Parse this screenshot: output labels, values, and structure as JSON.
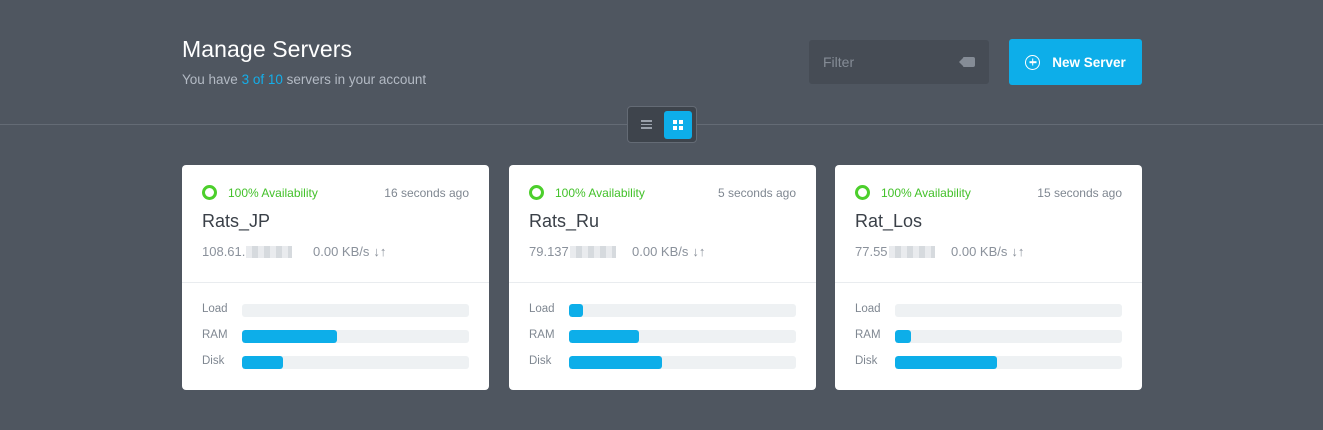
{
  "header": {
    "title": "Manage Servers",
    "subtitle_prefix": "You have ",
    "subtitle_count": "3 of 10",
    "subtitle_suffix": " servers in your account"
  },
  "filter": {
    "placeholder": "Filter",
    "icon": "tag-icon"
  },
  "new_server_button": {
    "label": "New Server",
    "icon": "plus-circle-icon"
  },
  "view_toggle": {
    "options": [
      "list",
      "grid"
    ],
    "selected": "grid"
  },
  "colors": {
    "accent": "#0daee9",
    "status_ok": "#43c12a",
    "background": "#4f5660"
  },
  "servers": [
    {
      "availability": "100% Availability",
      "last_seen": "16 seconds ago",
      "name": "Rats_JP",
      "ip_visible": "108.61.",
      "speed": "0.00 KB/s",
      "arrows": "↓↑",
      "metrics": [
        {
          "label": "Load",
          "percent": 0
        },
        {
          "label": "RAM",
          "percent": 42
        },
        {
          "label": "Disk",
          "percent": 18
        }
      ]
    },
    {
      "availability": "100% Availability",
      "last_seen": "5 seconds ago",
      "name": "Rats_Ru",
      "ip_visible": "79.137",
      "speed": "0.00 KB/s",
      "arrows": "↓↑",
      "metrics": [
        {
          "label": "Load",
          "percent": 6
        },
        {
          "label": "RAM",
          "percent": 31
        },
        {
          "label": "Disk",
          "percent": 41
        }
      ]
    },
    {
      "availability": "100% Availability",
      "last_seen": "15 seconds ago",
      "name": "Rat_Los",
      "ip_visible": "77.55",
      "speed": "0.00 KB/s",
      "arrows": "↓↑",
      "metrics": [
        {
          "label": "Load",
          "percent": 0
        },
        {
          "label": "RAM",
          "percent": 7
        },
        {
          "label": "Disk",
          "percent": 45
        }
      ]
    }
  ]
}
